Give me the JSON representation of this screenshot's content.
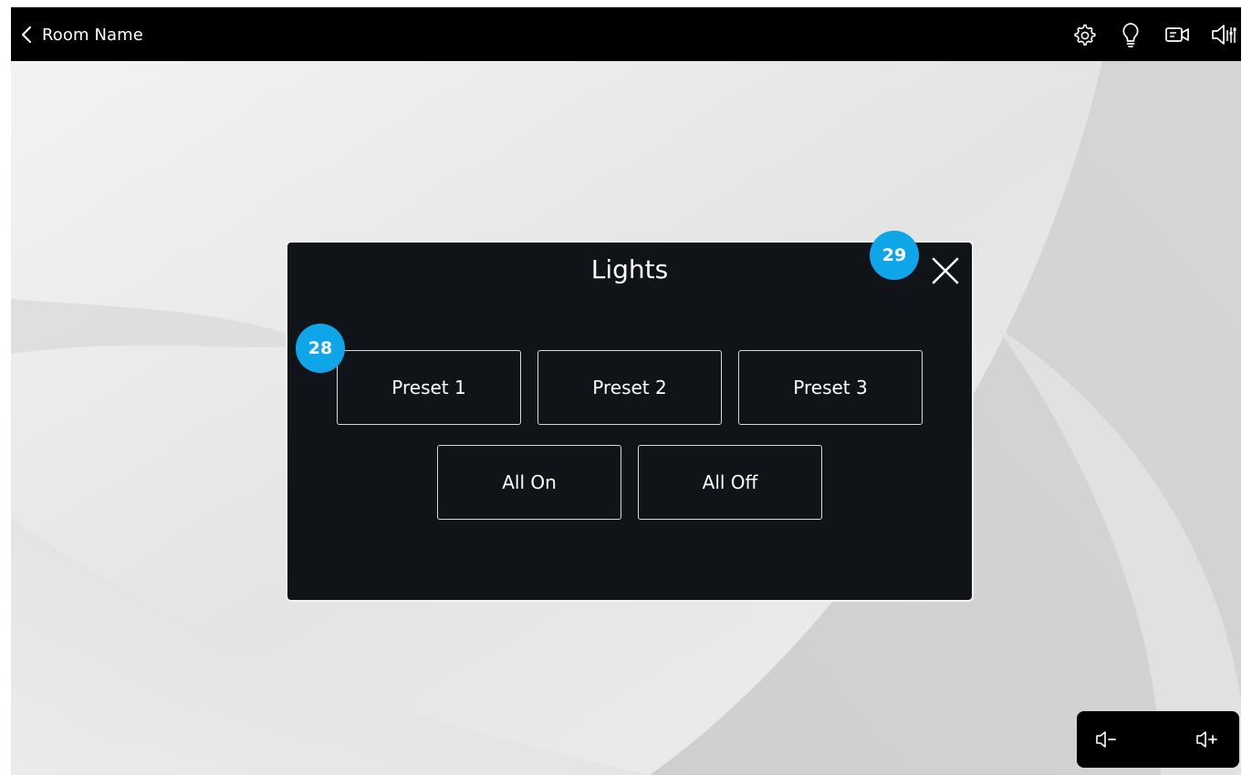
{
  "header": {
    "room_name": "Room Name",
    "back_icon": "chevron-left-icon",
    "icons": [
      "gear-icon",
      "lightbulb-icon",
      "camera-icon",
      "speaker-icon"
    ]
  },
  "lights_modal": {
    "title": "Lights",
    "close_icon": "close-icon",
    "presets": [
      {
        "label": "Preset 1"
      },
      {
        "label": "Preset 2"
      },
      {
        "label": "Preset 3"
      }
    ],
    "all_on_label": "All On",
    "all_off_label": "All Off"
  },
  "badges": {
    "preset_badge": "28",
    "close_badge": "29"
  },
  "volume": {
    "down_icon": "volume-down-icon",
    "up_icon": "volume-up-icon"
  },
  "colors": {
    "badge": "#0ea5e9",
    "modal_bg": "#101317",
    "topbar_bg": "#000000"
  }
}
